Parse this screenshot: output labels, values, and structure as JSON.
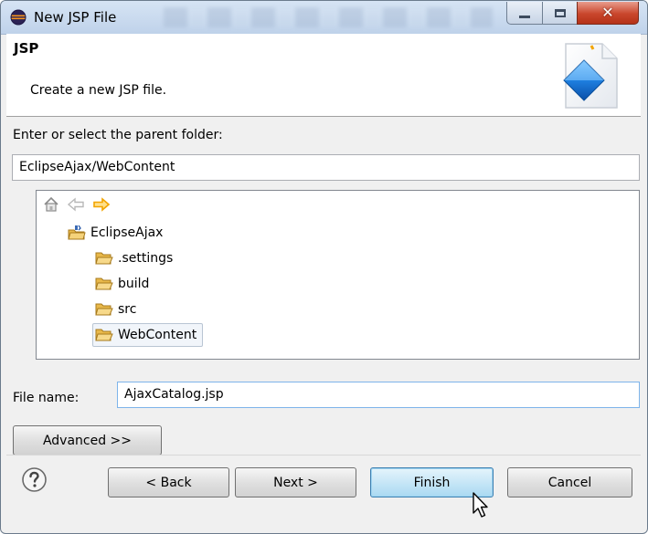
{
  "window": {
    "title": "New JSP File"
  },
  "header": {
    "title": "JSP",
    "description": "Create a new JSP file."
  },
  "folder": {
    "label": "Enter or select the parent folder:",
    "value": "EclipseAjax/WebContent"
  },
  "tree": {
    "nav_icons": [
      "home-icon",
      "back-arrow-icon",
      "forward-arrow-icon"
    ],
    "project": {
      "label": "EclipseAjax",
      "icon": "project-icon"
    },
    "folders": [
      {
        "label": ".settings",
        "icon": "folder-open-icon",
        "selected": false
      },
      {
        "label": "build",
        "icon": "folder-open-icon",
        "selected": false
      },
      {
        "label": "src",
        "icon": "folder-open-icon",
        "selected": false
      },
      {
        "label": "WebContent",
        "icon": "folder-open-icon",
        "selected": true
      }
    ]
  },
  "file": {
    "label": "File name:",
    "value": "AjaxCatalog.jsp"
  },
  "buttons": {
    "advanced": "Advanced >>",
    "back": "< Back",
    "next": "Next >",
    "finish": "Finish",
    "cancel": "Cancel"
  },
  "colors": {
    "accent": "#3c7fb1",
    "folder": "#e8b84a",
    "arrow_active": "#f2a400"
  }
}
